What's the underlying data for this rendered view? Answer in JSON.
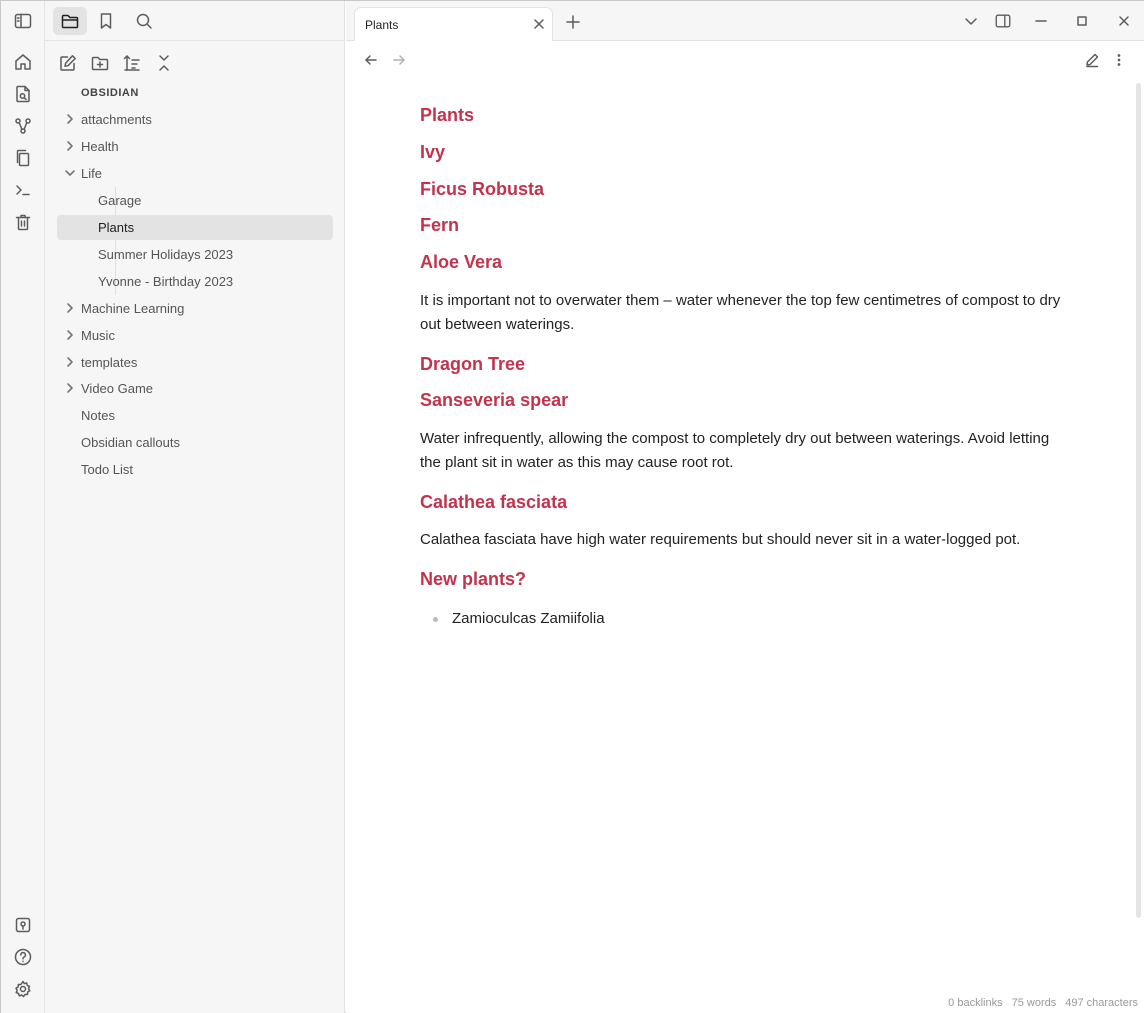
{
  "ribbon": {
    "top_icons": [
      "home-icon",
      "file-search-icon",
      "graph-icon",
      "files-icon",
      "terminal-icon",
      "trash-icon"
    ],
    "bottom_icons": [
      "vault-switcher-icon",
      "help-icon",
      "settings-icon"
    ]
  },
  "sidebar": {
    "tabs": [
      "folder-icon",
      "bookmark-icon",
      "search-icon"
    ],
    "actions": [
      "new-note-icon",
      "new-folder-icon",
      "sort-icon",
      "collapse-all-icon"
    ],
    "vault_name": "OBSIDIAN",
    "tree": [
      {
        "label": "attachments",
        "kind": "folder",
        "expanded": false
      },
      {
        "label": "Health",
        "kind": "folder",
        "expanded": false
      },
      {
        "label": "Life",
        "kind": "folder",
        "expanded": true
      },
      {
        "label": "Garage",
        "kind": "file",
        "depth": 1
      },
      {
        "label": "Plants",
        "kind": "file",
        "depth": 1,
        "selected": true
      },
      {
        "label": "Summer Holidays 2023",
        "kind": "file",
        "depth": 1
      },
      {
        "label": "Yvonne - Birthday 2023",
        "kind": "file",
        "depth": 1
      },
      {
        "label": "Machine Learning",
        "kind": "folder",
        "expanded": false
      },
      {
        "label": "Music",
        "kind": "folder",
        "expanded": false
      },
      {
        "label": "templates",
        "kind": "folder",
        "expanded": false
      },
      {
        "label": "Video Game",
        "kind": "folder",
        "expanded": false
      },
      {
        "label": "Notes",
        "kind": "file"
      },
      {
        "label": "Obsidian callouts",
        "kind": "file"
      },
      {
        "label": "Todo List",
        "kind": "file"
      }
    ]
  },
  "tabs": [
    {
      "title": "Plants",
      "active": true
    }
  ],
  "document": {
    "headings": [
      "Plants",
      "Ivy",
      "Ficus Robusta",
      "Fern",
      "Aloe Vera",
      "Dragon Tree",
      "Sanseveria spear",
      "Calathea fasciata",
      "New plants?"
    ],
    "paragraphs": [
      "It is important not to overwater them – water whenever the top few centimetres of compost to dry out between waterings.",
      "Water infrequently, allowing the compost to completely dry out between waterings. Avoid letting the plant sit in water as this may cause root rot.",
      "Calathea fasciata have high water requirements but should never sit in a water-logged pot."
    ],
    "list_items": [
      "Zamioculcas Zamiifolia"
    ]
  },
  "status": {
    "backlinks": "0 backlinks",
    "words": "75 words",
    "characters": "497 characters"
  },
  "colors": {
    "accent_heading": "#c2344d",
    "sidebar_bg": "#f6f6f6",
    "selected_bg": "#e3e3e3"
  }
}
